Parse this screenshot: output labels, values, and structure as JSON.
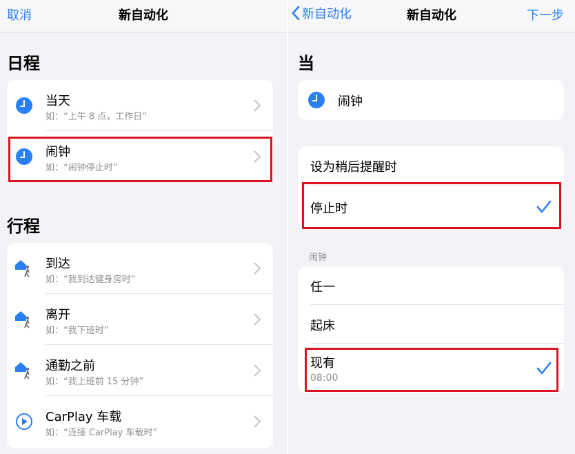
{
  "left": {
    "nav": {
      "cancel": "取消",
      "title": "新自动化"
    },
    "schedule": {
      "header": "日程",
      "items": [
        {
          "title": "当天",
          "subtitle": "如：“上午 8 点，工作日”",
          "icon": "clock-icon"
        },
        {
          "title": "闹钟",
          "subtitle": "如：“闹钟停止时”",
          "icon": "clock-icon",
          "highlighted": true
        }
      ]
    },
    "travel": {
      "header": "行程",
      "items": [
        {
          "title": "到达",
          "subtitle": "如：“我到达健身房时”",
          "icon": "home-person-icon"
        },
        {
          "title": "离开",
          "subtitle": "如：“我下班时”",
          "icon": "home-person-icon"
        },
        {
          "title": "通勤之前",
          "subtitle": "如：“我上班前 15 分钟”",
          "icon": "home-person-icon"
        },
        {
          "title": "CarPlay 车载",
          "subtitle": "如：“连接 CarPlay 车载时”",
          "icon": "carplay-icon"
        }
      ]
    }
  },
  "right": {
    "nav": {
      "back": "新自动化",
      "title": "新自动化",
      "next": "下一步"
    },
    "when": {
      "header": "当",
      "item": "闹钟"
    },
    "trigger_options": [
      {
        "label": "设为稍后提醒时",
        "checked": false
      },
      {
        "label": "停止时",
        "checked": true,
        "highlighted": true
      }
    ],
    "alarm_group": {
      "label": "闹钟",
      "options": [
        {
          "label": "任一",
          "checked": false
        },
        {
          "label": "起床",
          "checked": false
        },
        {
          "label": "现有",
          "sub": "08:00",
          "checked": true,
          "highlighted": true
        }
      ]
    }
  },
  "colors": {
    "accent": "#2a7ff5",
    "highlight": "#d9141e",
    "background": "#f2f2f7"
  }
}
